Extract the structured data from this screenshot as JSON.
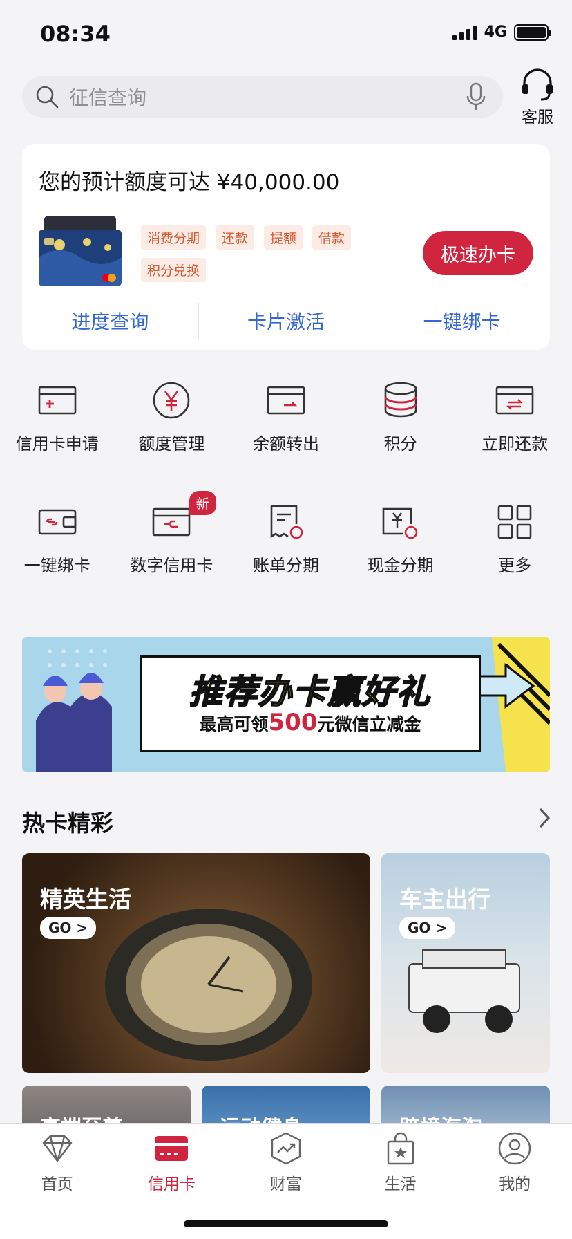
{
  "status": {
    "time": "08:34",
    "network": "4G"
  },
  "search": {
    "placeholder": "征信查询",
    "service_label": "客服"
  },
  "card_panel": {
    "title": "您的预计额度可达 ¥40,000.00",
    "tags": [
      "消费分期",
      "还款",
      "提额",
      "借款",
      "积分兑换"
    ],
    "action": "极速办卡",
    "links": [
      "进度查询",
      "卡片激活",
      "一键绑卡"
    ]
  },
  "grid": [
    {
      "label": "信用卡申请",
      "icon": "card-apply-icon"
    },
    {
      "label": "额度管理",
      "icon": "credit-limit-icon"
    },
    {
      "label": "余额转出",
      "icon": "balance-transfer-icon"
    },
    {
      "label": "积分",
      "icon": "points-icon"
    },
    {
      "label": "立即还款",
      "icon": "repay-icon"
    },
    {
      "label": "一键绑卡",
      "icon": "bind-card-icon"
    },
    {
      "label": "数字信用卡",
      "icon": "digital-card-icon",
      "badge": "新"
    },
    {
      "label": "账单分期",
      "icon": "bill-installment-icon"
    },
    {
      "label": "现金分期",
      "icon": "cash-installment-icon"
    },
    {
      "label": "更多",
      "icon": "more-grid-icon"
    }
  ],
  "banner": {
    "headline": "推荐办卡赢好礼",
    "sub_prefix": "最高可领",
    "sub_amount": "500",
    "sub_suffix": "元微信立减金"
  },
  "hot_cards": {
    "title": "热卡精彩",
    "go_label": "GO >",
    "tiles": [
      "精英生活",
      "车主出行",
      "高端至尊",
      "运动健身",
      "跨境海淘"
    ]
  },
  "tabbar": [
    {
      "label": "首页",
      "icon": "diamond-icon"
    },
    {
      "label": "信用卡",
      "icon": "credit-card-icon"
    },
    {
      "label": "财富",
      "icon": "chart-trend-icon"
    },
    {
      "label": "生活",
      "icon": "shopping-bag-icon"
    },
    {
      "label": "我的",
      "icon": "user-icon"
    }
  ],
  "colors": {
    "brand_red": "#d1253f",
    "link_blue": "#3467d6",
    "tag_orange": "#d4582f"
  }
}
